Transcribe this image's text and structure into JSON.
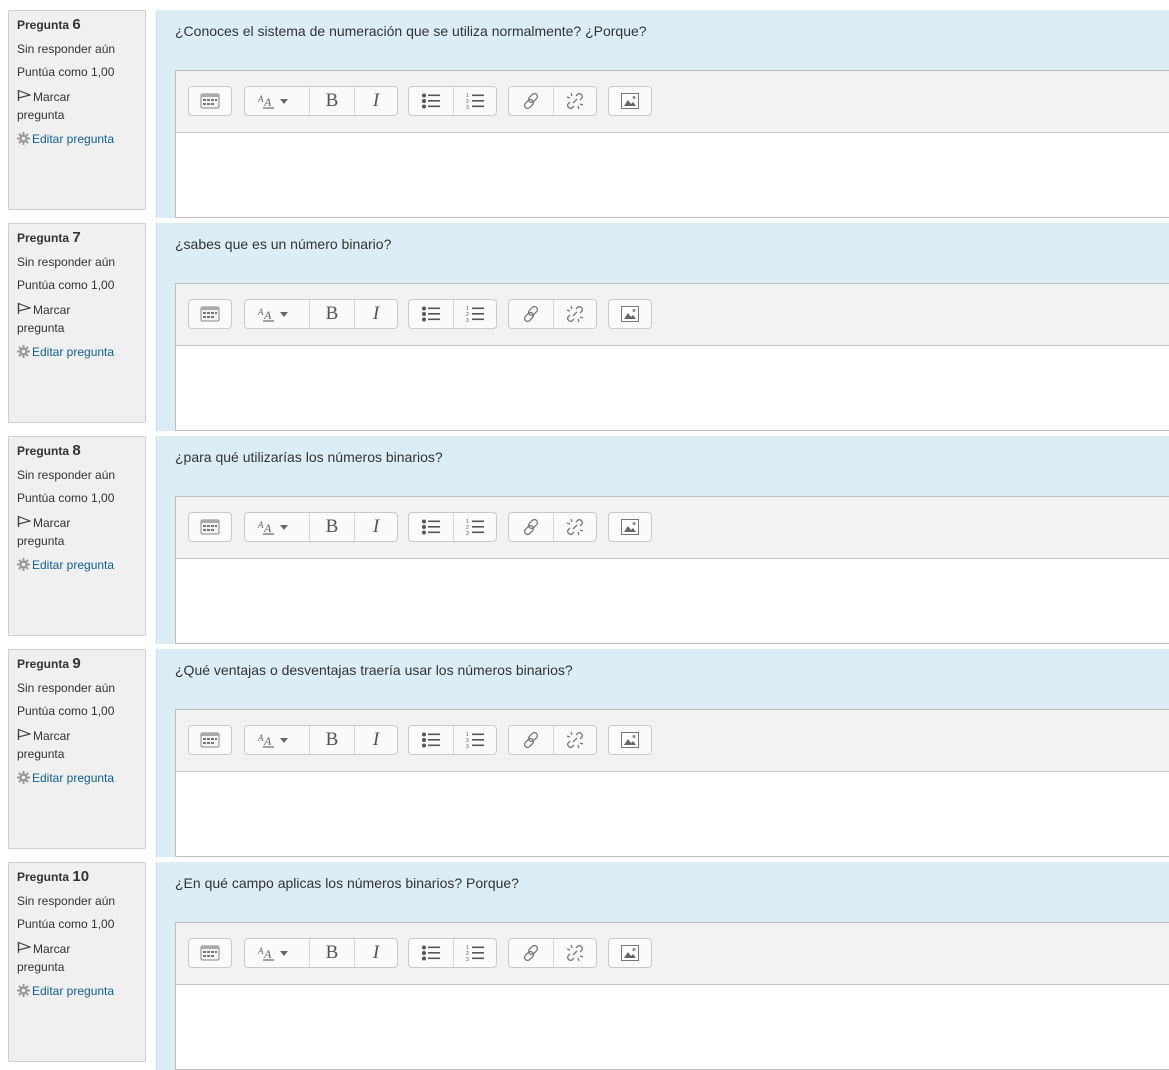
{
  "labels": {
    "question_prefix": "Pregunta",
    "status": "Sin responder aún",
    "score": "Puntúa como 1,00",
    "flag": "Marcar",
    "flag2": "pregunta",
    "edit": "Editar pregunta"
  },
  "questions": [
    {
      "number": "6",
      "text": "¿Conoces el sistema de numeración que se utiliza normalmente? ¿Porque?"
    },
    {
      "number": "7",
      "text": "¿sabes que es un número binario?"
    },
    {
      "number": "8",
      "text": "¿para qué utilizarías los números binarios?"
    },
    {
      "number": "9",
      "text": "¿Qué ventajas o desventajas traería usar los números binarios?"
    },
    {
      "number": "10",
      "text": "¿En qué campo aplicas los números binarios? Porque?"
    }
  ],
  "toolbar_icons": [
    "show-more-buttons-icon",
    "font-style-icon",
    "bold-icon",
    "italic-icon",
    "unordered-list-icon",
    "ordered-list-icon",
    "link-icon",
    "unlink-icon",
    "image-icon"
  ],
  "colors": {
    "question_bg": "#dcedf6",
    "info_bg": "#f0f0f0",
    "link": "#0f5f96"
  }
}
